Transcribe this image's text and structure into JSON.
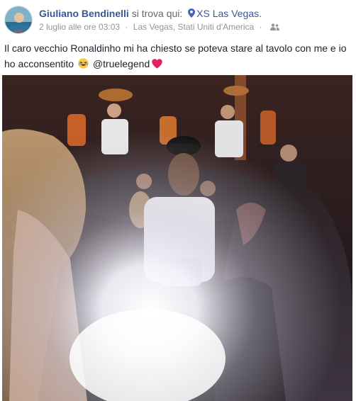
{
  "post": {
    "author": "Giuliano Bendinelli",
    "location_prefix": "si trova qui:",
    "location": "XS Las Vegas.",
    "timestamp": "2 luglio alle ore 03:03",
    "place_detail": "Las Vegas, Stati Uniti d'America",
    "separator": "·",
    "text_part1": "Il caro vecchio Ronaldinho mi ha chiesto se poteva stare al tavolo con me e io ho acconsentito",
    "text_part2": "@truelegend",
    "icons": {
      "location": "map-pin-icon",
      "privacy": "friends-icon",
      "laugh": "laughing-emoji-icon",
      "heart": "heart-icon"
    },
    "colors": {
      "link": "#365899",
      "meta": "#90949c",
      "heart": "#e0245e"
    }
  }
}
